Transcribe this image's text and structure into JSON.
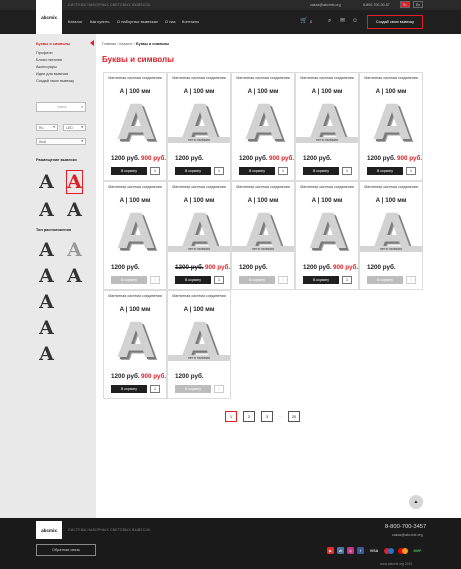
{
  "header": {
    "tagline": "СИСТЕМА НАБОРНЫХ СВЕТОВЫХ ВЫВЕСОК",
    "email": "zakaz@abcmix.org",
    "phone": "8-800-700-30-57",
    "lang": [
      "Ru",
      "En"
    ],
    "nav": [
      "Каталог",
      "Как купить",
      "О наборных вывесках",
      "О нас",
      "Контакты"
    ],
    "cart_count": "0",
    "create_button": "Создай свою вывеску",
    "logo_text": "abcmix"
  },
  "sidebar": {
    "categories": [
      "Буквы и символы",
      "Профили",
      "Блоки питания",
      "Аксессуары",
      "Идеи для вывески",
      "Создай свою вывеску"
    ],
    "active_category": "Буквы и символы",
    "search_placeholder": "поиск",
    "selects": [
      "Ru",
      "LED",
      "Arial"
    ],
    "placement_heading": "Размещение вывески",
    "mount_heading": "Тип расположения"
  },
  "main": {
    "breadcrumbs": [
      "Главная",
      "Каталог",
      "Буквы и символы"
    ],
    "breadcrumb_sep": "›",
    "page_title": "Буквы и символы",
    "product_title": "Магнитная система соединения",
    "product_size": "А | 100 мм",
    "product_letter": "A",
    "add_to_cart": "В корзину",
    "qty": "1",
    "in_stock": "нет в наличии",
    "products": [
      {
        "price": "1200 руб.",
        "old_price": "",
        "new_price": "900 руб.",
        "sale": true,
        "in_stock": true
      },
      {
        "price": "1200 руб.",
        "old_price": "",
        "new_price": "",
        "sale": false,
        "in_stock": false
      },
      {
        "price": "1200 руб.",
        "old_price": "",
        "new_price": "900 руб.",
        "sale": true,
        "in_stock": true
      },
      {
        "price": "1200 руб.",
        "old_price": "",
        "new_price": "",
        "sale": false,
        "in_stock": false
      },
      {
        "price": "1200 руб.",
        "old_price": "",
        "new_price": "900 руб.",
        "sale": true,
        "in_stock": true
      },
      {
        "price": "1200 руб.",
        "old_price": "",
        "new_price": "",
        "sale": false,
        "in_stock": true,
        "disabled": true
      },
      {
        "price": "",
        "old_price": "1200 руб.",
        "new_price": "900 руб.",
        "sale": true,
        "in_stock": false
      },
      {
        "price": "1200 руб.",
        "old_price": "",
        "new_price": "",
        "sale": false,
        "in_stock": false,
        "disabled": true
      },
      {
        "price": "1200 руб.",
        "old_price": "",
        "new_price": "900 руб.",
        "sale": true,
        "in_stock": true
      },
      {
        "price": "1200 руб.",
        "old_price": "",
        "new_price": "",
        "sale": false,
        "in_stock": false,
        "disabled": true
      },
      {
        "price": "1200 руб.",
        "old_price": "",
        "new_price": "900 руб.",
        "sale": true,
        "in_stock": true
      },
      {
        "price": "1200 руб.",
        "old_price": "",
        "new_price": "",
        "sale": false,
        "in_stock": false,
        "disabled": true
      }
    ],
    "pagination": [
      "1",
      "2",
      "3",
      "…",
      "20"
    ],
    "active_page": "1"
  },
  "footer": {
    "tagline": "СИСТЕМА НАБОРНЫХ СВЕТОВЫХ ВЫВЕСОК",
    "phone": "8-800-700-3457",
    "email": "zakaz@abcmix.org",
    "callback": "Обратная связь",
    "social": [
      "youtube-icon",
      "vk-icon",
      "instagram-icon",
      "facebook-icon"
    ],
    "payments": [
      "VISA",
      "Maestro",
      "MasterCard",
      "МИР"
    ],
    "copyright": "www.abcmix.org 2019"
  },
  "colors": {
    "accent": "#e21d26",
    "dark": "#1f1f1f",
    "sidebar": "#e9e9e9"
  }
}
